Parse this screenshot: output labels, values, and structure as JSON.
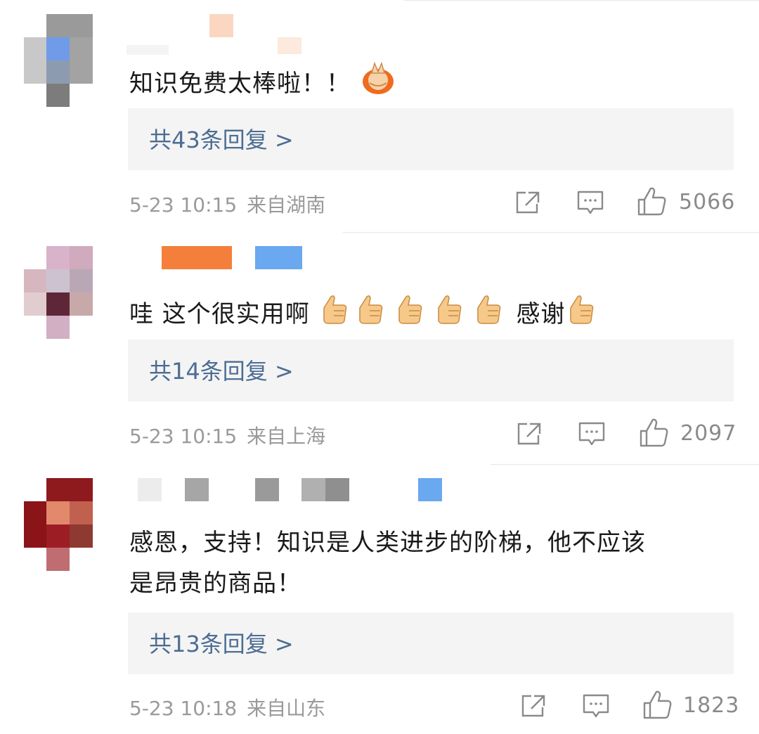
{
  "comments": [
    {
      "text": "知识免费太棒啦！！",
      "replies": "共43条回复 >",
      "time": "5-23 10:15",
      "location": "来自湖南",
      "likes": "5066"
    },
    {
      "text_a": "哇 这个很实用啊",
      "text_b": "感谢",
      "replies": "共14条回复 >",
      "time": "5-23 10:15",
      "location": "来自上海",
      "likes": "2097"
    },
    {
      "text_line1": "感恩，支持！知识是人类进步的阶梯，他不应该",
      "text_line2": "是昂贵的商品！",
      "replies": "共13条回复 >",
      "time": "5-23 10:18",
      "location": "来自山东",
      "likes": "1823"
    }
  ],
  "icons": {
    "share": "share-icon",
    "comment": "comment-icon",
    "like": "thumbs-up-icon",
    "emoji_1": "clapping-hands-emoji",
    "emoji_2": "thumbs-up-emoji"
  },
  "colors": {
    "reply_link": "#4c6d93",
    "meta": "#9a9a9a",
    "reply_bg": "#f4f4f4"
  }
}
